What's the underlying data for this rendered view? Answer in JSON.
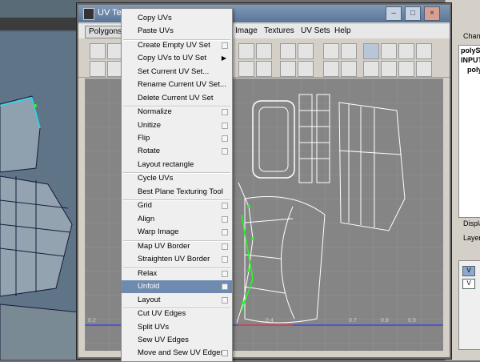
{
  "window": {
    "title": "UV Text"
  },
  "menubar": {
    "polygons": "Polygons",
    "items": [
      "Image",
      "Textures",
      "UV Sets",
      "Help"
    ]
  },
  "right_panel": {
    "channel_label": "Chann",
    "lines": [
      "polyS",
      "INPUT",
      "poly"
    ],
    "display_label": "Displa",
    "layer_label": "Layer",
    "v_labels": [
      "V",
      "V"
    ]
  },
  "uv_axis": {
    "ticks": [
      "0.2",
      "0.4",
      "0.7",
      "0.8",
      "0.9"
    ],
    "axis_color": "#2b3bff"
  },
  "dropdown": {
    "items": [
      {
        "label": "Copy UVs",
        "option": false,
        "submenu": false
      },
      {
        "label": "Paste UVs",
        "option": false,
        "submenu": false
      },
      {
        "label": "Create Empty UV Set",
        "option": true,
        "submenu": false
      },
      {
        "label": "Copy UVs to UV Set",
        "option": false,
        "submenu": true
      },
      {
        "label": "Set Current UV Set...",
        "option": false,
        "submenu": false
      },
      {
        "label": "Rename Current UV Set...",
        "option": false,
        "submenu": false
      },
      {
        "label": "Delete Current UV Set",
        "option": false,
        "submenu": false
      },
      {
        "label": "Normalize",
        "option": true,
        "submenu": false
      },
      {
        "label": "Unitize",
        "option": true,
        "submenu": false
      },
      {
        "label": "Flip",
        "option": true,
        "submenu": false
      },
      {
        "label": "Rotate",
        "option": true,
        "submenu": false
      },
      {
        "label": "Layout rectangle",
        "option": false,
        "submenu": false
      },
      {
        "label": "Cycle UVs",
        "option": false,
        "submenu": false
      },
      {
        "label": "Best Plane Texturing Tool",
        "option": false,
        "submenu": false
      },
      {
        "label": "Grid",
        "option": true,
        "submenu": false
      },
      {
        "label": "Align",
        "option": true,
        "submenu": false
      },
      {
        "label": "Warp Image",
        "option": true,
        "submenu": false
      },
      {
        "label": "Map UV Border",
        "option": true,
        "submenu": false
      },
      {
        "label": "Straighten UV Border",
        "option": true,
        "submenu": false
      },
      {
        "label": "Relax",
        "option": true,
        "submenu": false
      },
      {
        "label": "Unfold",
        "option": true,
        "submenu": false,
        "highlighted": true
      },
      {
        "label": "Layout",
        "option": true,
        "submenu": false
      },
      {
        "label": "Cut UV Edges",
        "option": false,
        "submenu": false
      },
      {
        "label": "Split UVs",
        "option": false,
        "submenu": false
      },
      {
        "label": "Sew UV Edges",
        "option": false,
        "submenu": false
      },
      {
        "label": "Move and Sew UV Edges",
        "option": true,
        "submenu": false
      }
    ]
  },
  "colors": {
    "highlight": "#6e8aaf",
    "selection_green": "#22ff22"
  }
}
